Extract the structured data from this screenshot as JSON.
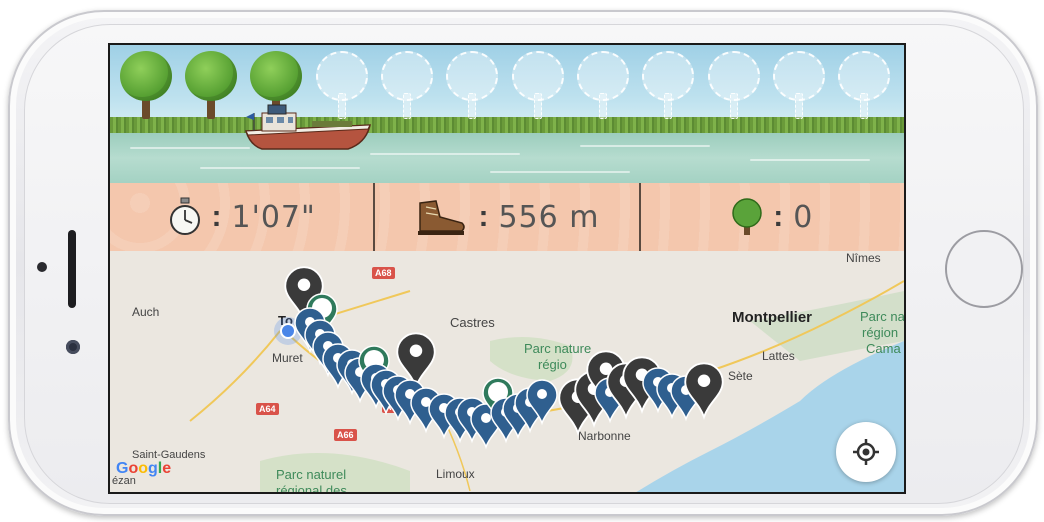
{
  "stats": {
    "time": {
      "icon": "stopwatch-icon",
      "value": "1'07\""
    },
    "distance": {
      "icon": "hiking-boot-icon",
      "value": "556 m"
    },
    "trees": {
      "icon": "tree-icon",
      "value": "0"
    }
  },
  "scene": {
    "trees_planted": 3,
    "trees_total": 12
  },
  "map": {
    "labels": {
      "nimes": "Nîmes",
      "auch": "Auch",
      "toulouse": "To",
      "castres": "Castres",
      "montpellier": "Montpellier",
      "parc_region_1": "Parc na",
      "parc_region_2": "région",
      "parc_region_3": "Cama",
      "muret": "Muret",
      "parc_nature": "Parc nature",
      "parc_nature_2": "régio",
      "lattes": "Lattes",
      "sete": "Sète",
      "narbonne": "Narbonne",
      "saint_gaudens": "Saint-Gaudens",
      "lezan": "ézan",
      "parc_naturel": "Parc naturel",
      "regional_des": "régional des",
      "limoux": "Limoux"
    },
    "roads": {
      "a68": "A68",
      "a64": "A64",
      "a66": "A66",
      "a6x": "A6"
    },
    "google": {
      "g1": "G",
      "g2": "o",
      "g3": "o",
      "g4": "g",
      "g5": "l",
      "g6": "e"
    },
    "locate_button": "crosshair-icon",
    "colors": {
      "blue_pin": "#2f5f8f",
      "green_pin": "#2f7a5c",
      "gray_pin": "#3a3a3a",
      "sea": "#a9d4ea",
      "user_dot": "#4a86e8"
    }
  },
  "colors": {
    "stats_bg": "#f4c7ad",
    "sky": "#bfe2ef",
    "water": "#a7cfc2",
    "grass": "#6a9a3a"
  }
}
